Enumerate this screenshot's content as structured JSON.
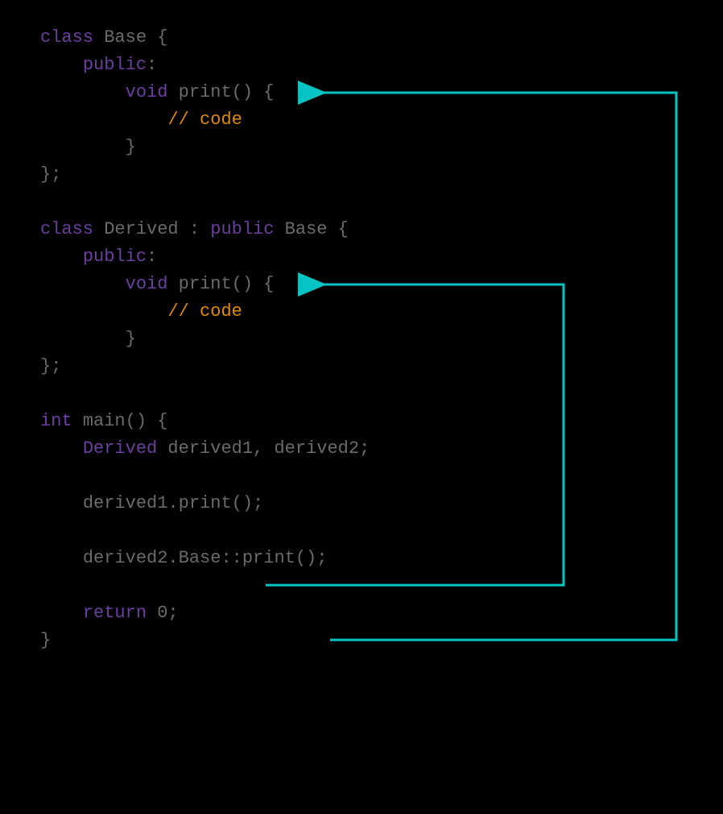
{
  "colors": {
    "keyword": "#6b3fa0",
    "comment": "#e08a00",
    "plain": "#6b6b6b",
    "arrow": "#06c4c4",
    "background": "#000000"
  },
  "code": {
    "l1_class": "class",
    "l1_rest": " Base {",
    "l2_public": "public",
    "l2_colon": ":",
    "l3_void": "void",
    "l3_rest": " print() {",
    "l4_comment": "// code",
    "l5_brace": "}",
    "l6_end": "};",
    "l7_class": "class",
    "l7_mid": " Derived : ",
    "l7_public": "public",
    "l7_rest": " Base {",
    "l8_public": "public",
    "l8_colon": ":",
    "l9_void": "void",
    "l9_rest": " print() {",
    "l10_comment": "// code",
    "l11_brace": "}",
    "l12_end": "};",
    "l13_int": "int",
    "l13_rest": " main() {",
    "l14_type": "Derived",
    "l14_rest": " derived1, derived2;",
    "l15_call": "derived1.print();",
    "l16_call": "derived2.Base::print();",
    "l17_return": "return",
    "l17_rest": " 0;",
    "l18_brace": "}"
  },
  "indent": {
    "i1": "    ",
    "i2": "        ",
    "i3": "            "
  },
  "arrows": [
    {
      "from": "derived1.print()",
      "to": "Derived::print()",
      "description": "call resolves to overridden Derived method"
    },
    {
      "from": "derived2.Base::print()",
      "to": "Base::print()",
      "description": "scoped call resolves to Base method"
    }
  ]
}
